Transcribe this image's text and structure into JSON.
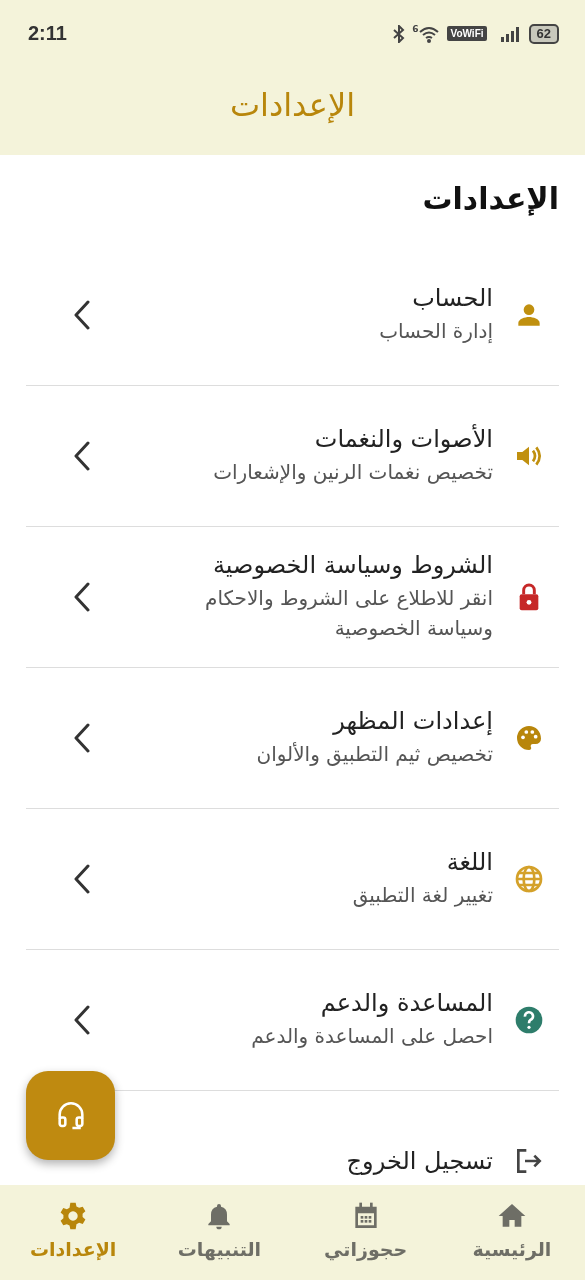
{
  "status_bar": {
    "time": "2:11",
    "wifi_badge": "6",
    "vowifi": "VoWiFi",
    "battery": "62"
  },
  "header": {
    "title": "الإعدادات"
  },
  "page_title": "الإعدادات",
  "items": [
    {
      "kind": "person",
      "color": "#c0900f",
      "title": "الحساب",
      "subtitle": "إدارة الحساب"
    },
    {
      "kind": "speaker",
      "color": "#c0900f",
      "title": "الأصوات والنغمات",
      "subtitle": "تخصيص نغمات الرنين والإشعارات"
    },
    {
      "kind": "lock",
      "color": "#c62828",
      "title": "الشروط وسياسة الخصوصية",
      "subtitle": "انقر للاطلاع على الشروط والاحكام وسياسة الخصوصية"
    },
    {
      "kind": "palette",
      "color": "#b8860b",
      "title": "إعدادات المظهر",
      "subtitle": "تخصيص ثيم التطبيق والألوان"
    },
    {
      "kind": "globe",
      "color": "#d4a12a",
      "title": "اللغة",
      "subtitle": "تغيير لغة التطبيق"
    },
    {
      "kind": "help",
      "color": "#2e7d6b",
      "title": "المساعدة والدعم",
      "subtitle": "احصل على المساعدة والدعم"
    },
    {
      "kind": "logout",
      "color": "#444444",
      "title": "تسجيل الخروج"
    }
  ],
  "nav": [
    {
      "kind": "home",
      "label": "الرئيسية",
      "selected": false
    },
    {
      "kind": "calendar",
      "label": "حجوزاتي",
      "selected": false
    },
    {
      "kind": "bell",
      "label": "التنبيهات",
      "selected": false
    },
    {
      "kind": "gear",
      "label": "الإعدادات",
      "selected": true
    }
  ]
}
